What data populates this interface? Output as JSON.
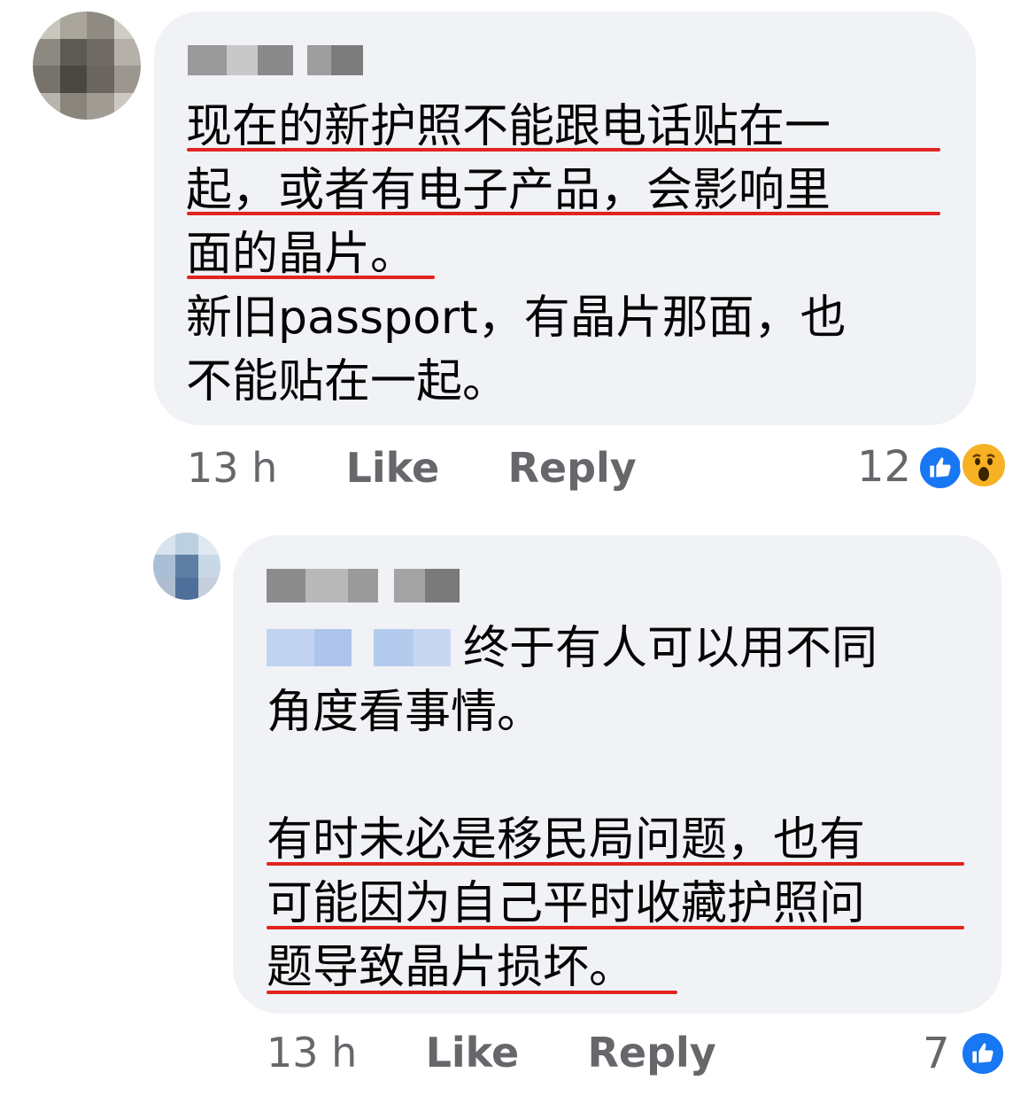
{
  "comments": [
    {
      "author_name": "",
      "text_lines": [
        "现在的新护照不能跟电话贴在一",
        "起，或者有电子产品，会影响里",
        "面的晶片。",
        "新旧passport，有晶片那面，也",
        "不能贴在一起。"
      ],
      "timestamp": "13 h",
      "like_label": "Like",
      "reply_label": "Reply",
      "reaction_count": "12",
      "reactions": [
        "like-icon",
        "wow-icon"
      ]
    }
  ],
  "reply": {
    "author_name": "",
    "mention_name": "",
    "paragraphs": [
      [
        "终于有人可以用不同",
        "角度看事情。"
      ],
      [
        "有时未必是移民局问题，也有",
        "可能因为自己平时收藏护照问",
        "题导致晶片损坏。"
      ]
    ],
    "timestamp": "13 h",
    "like_label": "Like",
    "reply_label": "Reply",
    "reaction_count": "7",
    "reactions": [
      "like-icon"
    ]
  },
  "colors": {
    "bubble": "#f0f2f5",
    "underline": "#e0241f",
    "meta_text": "#65676b",
    "like_blue": "#1877f2",
    "wow_yellow": "#f7b125"
  }
}
